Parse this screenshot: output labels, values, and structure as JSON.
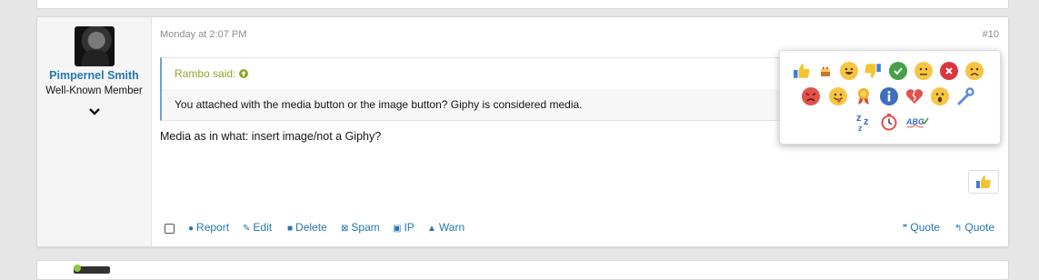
{
  "post": {
    "username": "Pimpernel Smith",
    "user_title": "Well-Known Member",
    "date": "Monday at 2:07 PM",
    "post_number": "#10",
    "quote": {
      "author_label": "Rambo said: ",
      "text": "You attached with the media button or the image button? Giphy is considered media."
    },
    "message": "Media as in what: insert image/not a Giphy?"
  },
  "actions": {
    "report": "Report",
    "edit": "Edit",
    "delete": "Delete",
    "spam": "Spam",
    "ip": "IP",
    "warn": "Warn",
    "multi_quote": "Quote",
    "quote": "Quote"
  },
  "reactions": [
    {
      "name": "like-icon"
    },
    {
      "name": "cake-icon"
    },
    {
      "name": "haha-icon"
    },
    {
      "name": "dislike-icon"
    },
    {
      "name": "agree-icon"
    },
    {
      "name": "neutral-icon"
    },
    {
      "name": "disagree-icon"
    },
    {
      "name": "sad-icon"
    },
    {
      "name": "angry-icon"
    },
    {
      "name": "tongue-icon"
    },
    {
      "name": "award-icon"
    },
    {
      "name": "info-icon"
    },
    {
      "name": "broken-heart-icon"
    },
    {
      "name": "wow-icon"
    },
    {
      "name": "wrench-icon"
    },
    {
      "name": "sleep-icon"
    },
    {
      "name": "clock-icon"
    },
    {
      "name": "spelling-icon"
    }
  ],
  "reaction_text": {
    "spelling": "ABC"
  },
  "colors": {
    "link": "#2577b1",
    "quote_author": "#8ea82b",
    "quote_border": "#6aa3d5"
  }
}
